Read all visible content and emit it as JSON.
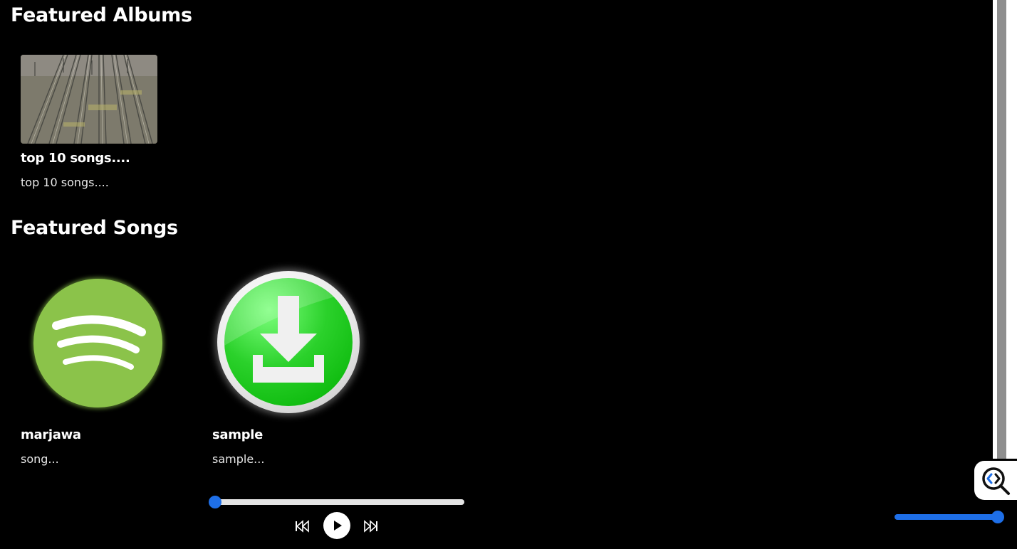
{
  "featured_albums": {
    "title": "Featured Albums",
    "items": [
      {
        "title": "top 10 songs....",
        "subtitle": "top 10 songs...."
      }
    ]
  },
  "featured_songs": {
    "title": "Featured Songs",
    "items": [
      {
        "title": "marjawa",
        "subtitle": "song..."
      },
      {
        "title": "sample",
        "subtitle": "sample..."
      }
    ]
  },
  "player": {
    "progress": 0,
    "volume": 1,
    "icons": {
      "previous": "skip-back-icon",
      "play": "play-icon",
      "next": "skip-forward-icon"
    }
  },
  "colors": {
    "background": "#000000",
    "accent": "#1e6fe8",
    "text": "#ffffff"
  }
}
